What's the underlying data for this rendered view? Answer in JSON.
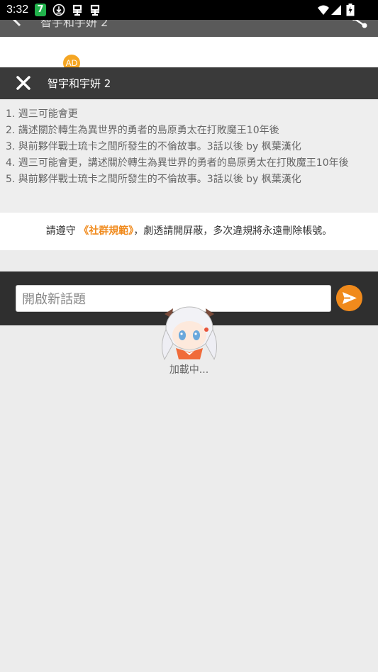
{
  "status_bar": {
    "time": "3:32",
    "badge": "7"
  },
  "header": {
    "title": "智宇和宇妍 2"
  },
  "ad": {
    "label": "AD"
  },
  "topic": {
    "title": "智宇和宇妍 2"
  },
  "description": {
    "lines": [
      "1. 週三可能會更",
      "2. 講述關於轉生為異世界的勇者的島原勇太在打敗魔王10年後",
      "3. 與前夥伴戰士琉卡之間所發生的不倫故事。3話以後 by 枫葉漢化",
      "4. 週三可能會更，講述關於轉生為異世界的勇者的島原勇太在打敗魔王10年後",
      "5. 與前夥伴戰士琉卡之間所發生的不倫故事。3話以後 by 枫葉漢化"
    ]
  },
  "rules": {
    "prefix": "請遵守 ",
    "link": "《社群規範》",
    "suffix": "，劇透請開屏蔽，多次違規將永遠刪除帳號。"
  },
  "compose": {
    "placeholder": "開啟新話題"
  },
  "loading": {
    "text": "加載中..."
  }
}
